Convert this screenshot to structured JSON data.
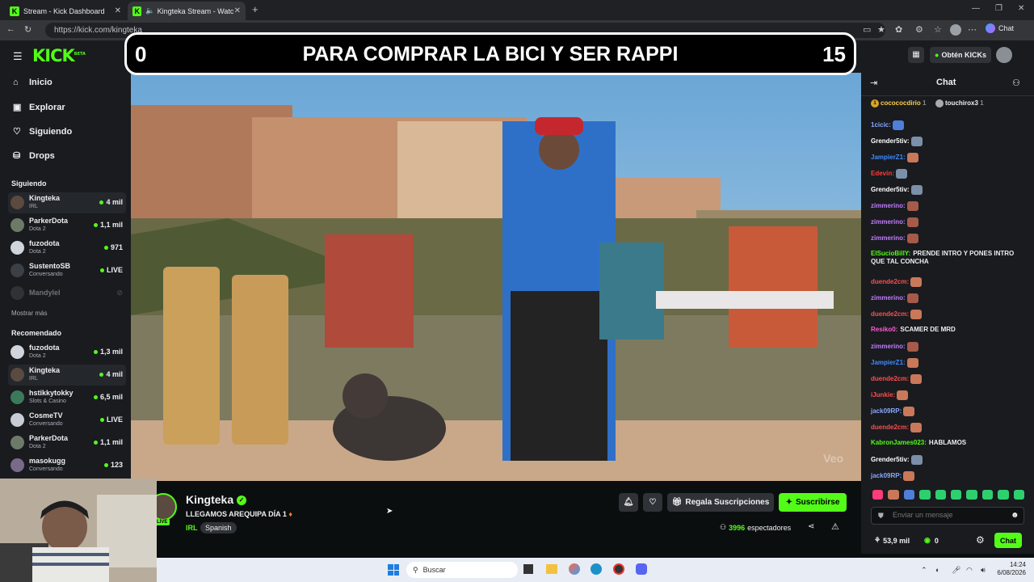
{
  "browser": {
    "tabs": [
      {
        "title": "Stream - Kick Dashboard",
        "active": false
      },
      {
        "title": "Kingteka Stream - Watch Live",
        "active": true
      }
    ],
    "url": "https://kick.com/kingteka",
    "chat_button": "Chat"
  },
  "header": {
    "logo": "KICK",
    "logo_badge": "BETA",
    "get_kicks": "Obtén KICKs"
  },
  "sidebar": {
    "nav": [
      {
        "label": "Inicio",
        "icon": "home-icon"
      },
      {
        "label": "Explorar",
        "icon": "compass-icon"
      },
      {
        "label": "Siguiendo",
        "icon": "heart-icon"
      },
      {
        "label": "Drops",
        "icon": "gift-icon"
      }
    ],
    "following_title": "Siguiendo",
    "following": [
      {
        "name": "Kingteka",
        "sub": "IRL",
        "count": "4 mil"
      },
      {
        "name": "ParkerDota",
        "sub": "Dota 2",
        "count": "1,1 mil"
      },
      {
        "name": "fuzodota",
        "sub": "Dota 2",
        "count": "971"
      },
      {
        "name": "SustentoSB",
        "sub": "Conversando",
        "count": "LIVE"
      },
      {
        "name": "Mandylel",
        "sub": "",
        "count": ""
      }
    ],
    "show_more": "Mostrar más",
    "recommended_title": "Recomendado",
    "recommended": [
      {
        "name": "fuzodota",
        "sub": "Dota 2",
        "count": "1,3 mil"
      },
      {
        "name": "Kingteka",
        "sub": "IRL",
        "count": "4 mil"
      },
      {
        "name": "hstikkytokky",
        "sub": "Slots & Casino",
        "count": "6,5 mil"
      },
      {
        "name": "CosmeTV",
        "sub": "Conversando",
        "count": "LIVE"
      },
      {
        "name": "ParkerDota",
        "sub": "Dota 2",
        "count": "1,1 mil"
      },
      {
        "name": "masokugg",
        "sub": "Conversando",
        "count": "123"
      }
    ]
  },
  "overlay": {
    "left_score": "0",
    "text": "PARA COMPRAR LA BICI Y SER RAPPI",
    "right_score": "15"
  },
  "stream": {
    "channel": "Kingteka",
    "title": "LLEGAMOS AREQUIPA DÍA 1",
    "category": "IRL",
    "language": "Spanish",
    "live_badge": "LIVE",
    "gift_button": "Regala Suscripciones",
    "subscribe_button": "Suscribirse",
    "viewers": "3996",
    "viewers_label": "espectadores",
    "watermark": "Veo"
  },
  "chat": {
    "title": "Chat",
    "pinned": [
      {
        "user": "cocococdirio",
        "count": "1"
      },
      {
        "user": "touchirox3",
        "count": "1"
      }
    ],
    "messages": [
      {
        "user": "1cicic:",
        "color": "#8aa8ff",
        "text": "",
        "emote": "#4f7fd8"
      },
      {
        "user": "Grender5tiv:",
        "color": "#ffffff",
        "text": "",
        "emote": "#7c8fa8"
      },
      {
        "user": "JampierZ1:",
        "color": "#3f8cff",
        "text": "",
        "emote": "#c9785a"
      },
      {
        "user": "Edevin:",
        "color": "#ff3b3b",
        "text": "",
        "emote": "#7c8fa8"
      },
      {
        "user": "Grender5tiv:",
        "color": "#ffffff",
        "text": "",
        "emote": "#7c8fa8"
      },
      {
        "user": "zimmerino:",
        "color": "#c27bff",
        "text": "",
        "emote": "#a55a4a"
      },
      {
        "user": "zimmerino:",
        "color": "#c27bff",
        "text": "",
        "emote": "#a55a4a"
      },
      {
        "user": "zimmerino:",
        "color": "#c27bff",
        "text": "",
        "emote": "#a55a4a"
      },
      {
        "user": "ElSucioBillY:",
        "color": "#53fc18",
        "text": "PRENDE INTRO Y PONES INTRO QUE TAL CONCHA",
        "emote": ""
      },
      {
        "user": "duende2cm:",
        "color": "#ff4d4d",
        "text": "",
        "emote": "#c9785a"
      },
      {
        "user": "zimmerino:",
        "color": "#c27bff",
        "text": "",
        "emote": "#a55a4a"
      },
      {
        "user": "duende2cm:",
        "color": "#ff4d4d",
        "text": "",
        "emote": "#c9785a"
      },
      {
        "user": "Resiko0:",
        "color": "#ff5ad1",
        "text": "SCAMER DE MRD",
        "emote": ""
      },
      {
        "user": "zimmerino:",
        "color": "#c27bff",
        "text": "",
        "emote": "#a55a4a"
      },
      {
        "user": "JampierZ1:",
        "color": "#3f8cff",
        "text": "",
        "emote": "#c9785a"
      },
      {
        "user": "duende2cm:",
        "color": "#ff4d4d",
        "text": "",
        "emote": "#c9785a"
      },
      {
        "user": "iJunkie:",
        "color": "#ff4d4d",
        "text": "",
        "emote": "#c9785a"
      },
      {
        "user": "jack09RP:",
        "color": "#8aa8ff",
        "text": "",
        "emote": "#c9785a"
      },
      {
        "user": "duende2cm:",
        "color": "#ff4d4d",
        "text": "",
        "emote": "#c9785a"
      },
      {
        "user": "KabronJames023:",
        "color": "#53fc18",
        "text": "HABLAMOS",
        "emote": ""
      },
      {
        "user": "Grender5tiv:",
        "color": "#ffffff",
        "text": "",
        "emote": "#7c8fa8"
      },
      {
        "user": "jack09RP:",
        "color": "#8aa8ff",
        "text": "",
        "emote": "#c9785a"
      }
    ],
    "input_placeholder": "Enviar un mensaje",
    "kicks": "53,9 mil",
    "points": "0",
    "send_button": "Chat"
  },
  "taskbar": {
    "search": "Buscar",
    "time": "14:24",
    "date": "6/08/2026"
  },
  "colors": {
    "brand": "#53fc18",
    "bg": "#0b0e0f",
    "panel": "#191b1f"
  }
}
